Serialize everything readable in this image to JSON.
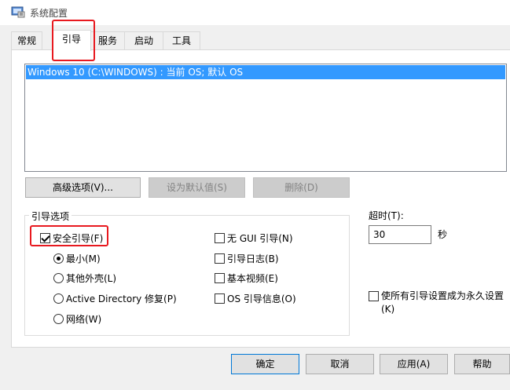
{
  "window": {
    "title": "系统配置",
    "icon": "msconfig-icon"
  },
  "tabs": [
    {
      "label": "常规",
      "active": false
    },
    {
      "label": "引导",
      "active": true
    },
    {
      "label": "服务",
      "active": false
    },
    {
      "label": "启动",
      "active": false
    },
    {
      "label": "工具",
      "active": false
    }
  ],
  "os_list": {
    "items": [
      "Windows 10 (C:\\WINDOWS) : 当前 OS; 默认 OS"
    ],
    "selected_index": 0
  },
  "os_buttons": {
    "advanced": "高级选项(V)...",
    "set_default": "设为默认值(S)",
    "delete": "删除(D)"
  },
  "boot_options": {
    "legend": "引导选项",
    "safe_boot": {
      "label": "安全引导(F)",
      "checked": true
    },
    "minimal": {
      "label": "最小(M)",
      "selected": true
    },
    "alternate_shell": {
      "label": "其他外壳(L)",
      "selected": false
    },
    "active_directory": {
      "label": "Active Directory 修复(P)",
      "selected": false
    },
    "network": {
      "label": "网络(W)",
      "selected": false
    },
    "no_gui": {
      "label": "无 GUI 引导(N)",
      "checked": false
    },
    "boot_log": {
      "label": "引导日志(B)",
      "checked": false
    },
    "base_video": {
      "label": "基本视频(E)",
      "checked": false
    },
    "os_info": {
      "label": "OS 引导信息(O)",
      "checked": false
    }
  },
  "timeout": {
    "label": "超时(T):",
    "value": "30",
    "unit": "秒"
  },
  "permanent": {
    "label_line1": "使所有引导设置成为永久设置",
    "label_line2": "(K)",
    "checked": false
  },
  "dialog_buttons": {
    "ok": "确定",
    "cancel": "取消",
    "apply": "应用(A)",
    "help": "帮助"
  },
  "colors": {
    "selection": "#3399ff",
    "highlight_box": "#e8191f",
    "focus_border": "#0078d7"
  }
}
